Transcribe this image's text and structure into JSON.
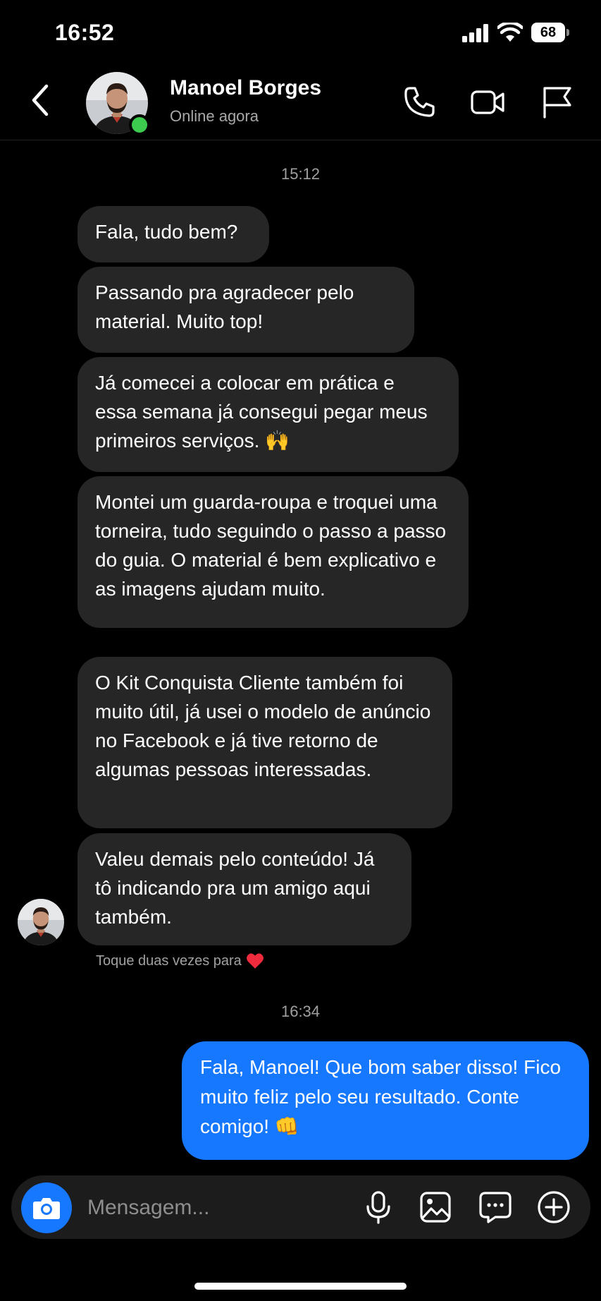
{
  "status_bar": {
    "time": "16:52",
    "battery": "68"
  },
  "header": {
    "contact_name": "Manoel Borges",
    "contact_status": "Online agora",
    "icons": [
      "back-icon",
      "phone-icon",
      "video-icon",
      "flag-icon"
    ]
  },
  "chat": {
    "timestamp_1": "15:12",
    "incoming": [
      "Fala, tudo bem?",
      "Passando pra agradecer pelo material. Muito top!",
      "Já comecei a colocar em prática e essa semana já consegui pegar meus primeiros serviços. 🙌",
      "Montei um guarda-roupa e troquei uma torneira, tudo seguindo o passo a passo do guia. O material é bem explicativo e as imagens ajudam muito.",
      "O Kit Conquista Cliente também foi muito útil, já usei o modelo de anúncio no Facebook e já tive retorno de algumas pessoas interessadas.",
      "Valeu demais pelo conteúdo! Já tô indicando pra um amigo aqui também."
    ],
    "hint": "Toque duas vezes para",
    "timestamp_2": "16:34",
    "outgoing": [
      "Fala, Manoel! Que bom saber disso! Fico muito feliz pelo seu resultado. Conte comigo! 👊"
    ]
  },
  "composer": {
    "placeholder": "Mensagem...",
    "icons": [
      "camera-icon",
      "microphone-icon",
      "gallery-icon",
      "sticker-icon",
      "plus-icon"
    ]
  },
  "colors": {
    "accent": "#1677ff",
    "incoming_bubble": "#262626",
    "online": "#3ccb4f"
  }
}
